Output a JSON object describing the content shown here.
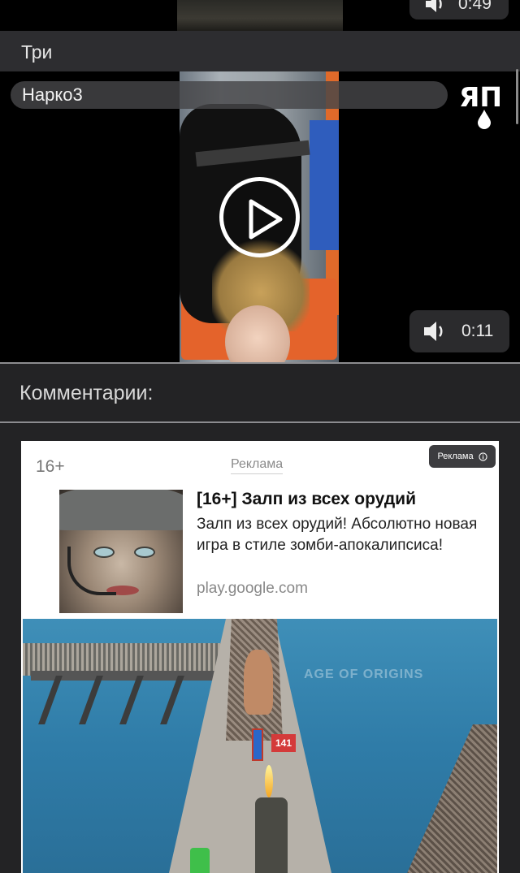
{
  "top_video": {
    "duration": "0:49"
  },
  "post": {
    "title": "Три"
  },
  "video": {
    "title": "Нарко3",
    "duration": "0:11",
    "logo_text": "ЯП"
  },
  "comments": {
    "header": "Комментарии:"
  },
  "ad": {
    "age_rating": "16+",
    "label": "Реклама",
    "badge": "Реклама",
    "title": "[16+] Залп из всех орудий",
    "description": "Залп из всех орудий! Абсолютно новая игра в стиле зомби-апокалипсиса!",
    "domain": "play.google.com",
    "media_score": "141",
    "media_watermark": "AGE OF ORIGINS"
  }
}
